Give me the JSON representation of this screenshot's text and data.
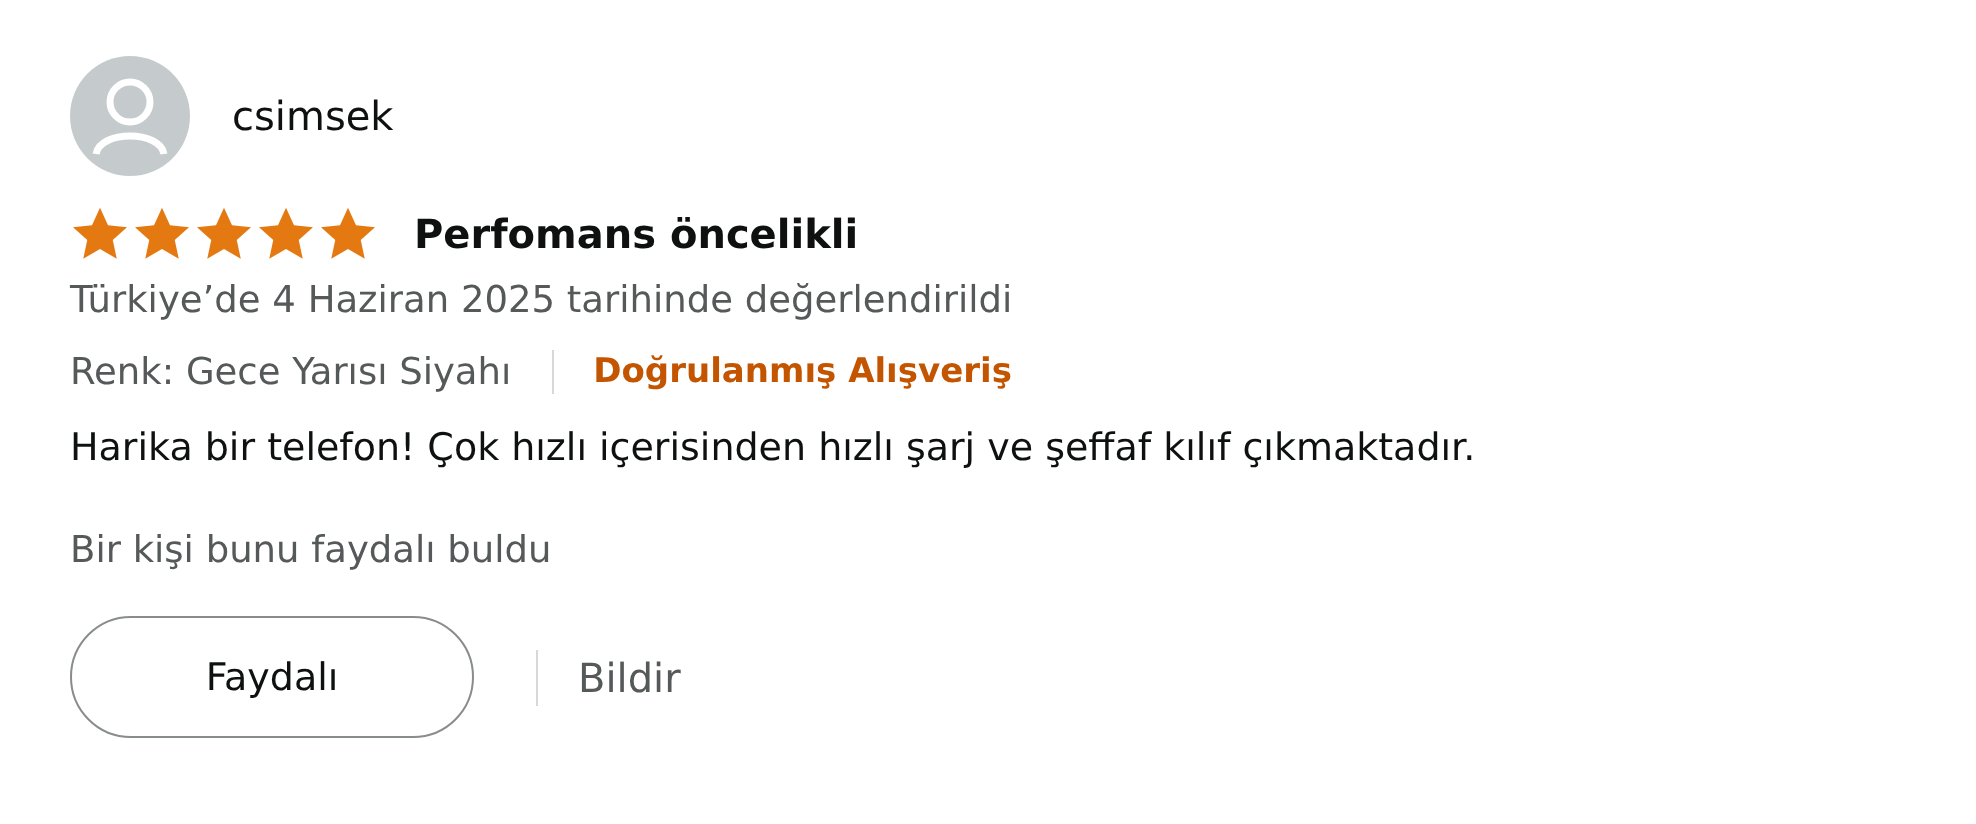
{
  "review": {
    "author": "csimsek",
    "stars": 5,
    "title": "Perfomans öncelikli",
    "date": "Türkiye’de 4 Haziran 2025 tarihinde değerlendirildi",
    "variant": "Renk: Gece Yarısı Siyahı",
    "verified": "Doğrulanmış Alışveriş",
    "body": "Harika bir telefon! Çok hızlı içerisinden hızlı şarj ve şeffaf kılıf çıkmaktadır.",
    "helpful_count": "Bir kişi bunu faydalı buldu",
    "helpful_button": "Faydalı",
    "report_link": "Bildir"
  }
}
